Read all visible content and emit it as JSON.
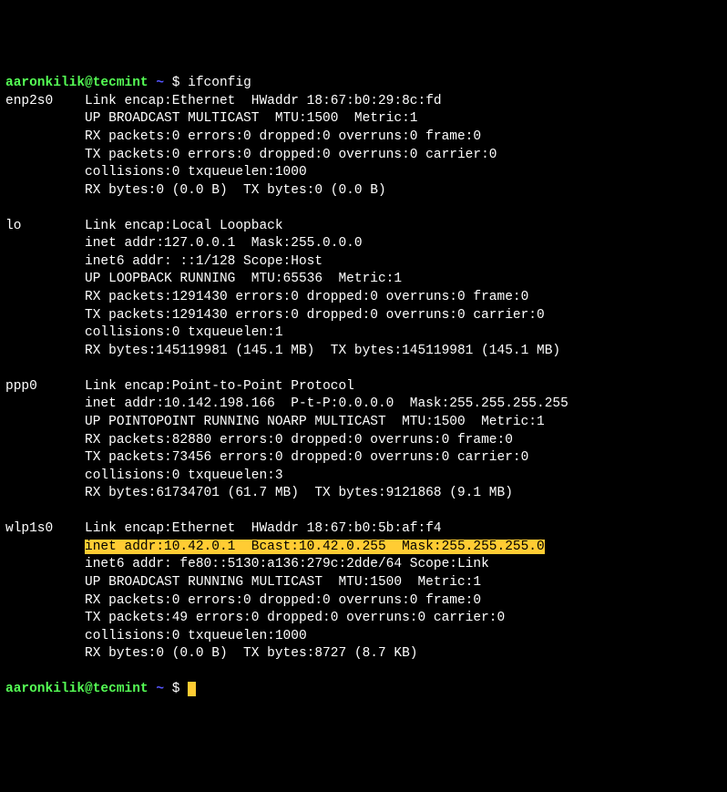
{
  "prompt": {
    "user_host": "aaronkilik@tecmint",
    "path": "~",
    "symbol": "$"
  },
  "command": "ifconfig",
  "interfaces": {
    "enp2s0": {
      "name": "enp2s0",
      "l1": "Link encap:Ethernet  HWaddr 18:67:b0:29:8c:fd",
      "l2": "UP BROADCAST MULTICAST  MTU:1500  Metric:1",
      "l3": "RX packets:0 errors:0 dropped:0 overruns:0 frame:0",
      "l4": "TX packets:0 errors:0 dropped:0 overruns:0 carrier:0",
      "l5": "collisions:0 txqueuelen:1000",
      "l6": "RX bytes:0 (0.0 B)  TX bytes:0 (0.0 B)"
    },
    "lo": {
      "name": "lo",
      "l1": "Link encap:Local Loopback",
      "l2": "inet addr:127.0.0.1  Mask:255.0.0.0",
      "l3": "inet6 addr: ::1/128 Scope:Host",
      "l4": "UP LOOPBACK RUNNING  MTU:65536  Metric:1",
      "l5": "RX packets:1291430 errors:0 dropped:0 overruns:0 frame:0",
      "l6": "TX packets:1291430 errors:0 dropped:0 overruns:0 carrier:0",
      "l7": "collisions:0 txqueuelen:1",
      "l8": "RX bytes:145119981 (145.1 MB)  TX bytes:145119981 (145.1 MB)"
    },
    "ppp0": {
      "name": "ppp0",
      "l1": "Link encap:Point-to-Point Protocol",
      "l2": "inet addr:10.142.198.166  P-t-P:0.0.0.0  Mask:255.255.255.255",
      "l3": "UP POINTOPOINT RUNNING NOARP MULTICAST  MTU:1500  Metric:1",
      "l4": "RX packets:82880 errors:0 dropped:0 overruns:0 frame:0",
      "l5": "TX packets:73456 errors:0 dropped:0 overruns:0 carrier:0",
      "l6": "collisions:0 txqueuelen:3",
      "l7": "RX bytes:61734701 (61.7 MB)  TX bytes:9121868 (9.1 MB)"
    },
    "wlp1s0": {
      "name": "wlp1s0",
      "l1": "Link encap:Ethernet  HWaddr 18:67:b0:5b:af:f4",
      "l2_hl": "inet addr:10.42.0.1  Bcast:10.42.0.255  Mask:255.255.255.0",
      "l3": "inet6 addr: fe80::5130:a136:279c:2dde/64 Scope:Link",
      "l4": "UP BROADCAST RUNNING MULTICAST  MTU:1500  Metric:1",
      "l5": "RX packets:0 errors:0 dropped:0 overruns:0 frame:0",
      "l6": "TX packets:49 errors:0 dropped:0 overruns:0 carrier:0",
      "l7": "collisions:0 txqueuelen:1000",
      "l8": "RX bytes:0 (0.0 B)  TX bytes:8727 (8.7 KB)"
    }
  },
  "indent": {
    "iface_pad": "    ",
    "body_pad": "          "
  }
}
